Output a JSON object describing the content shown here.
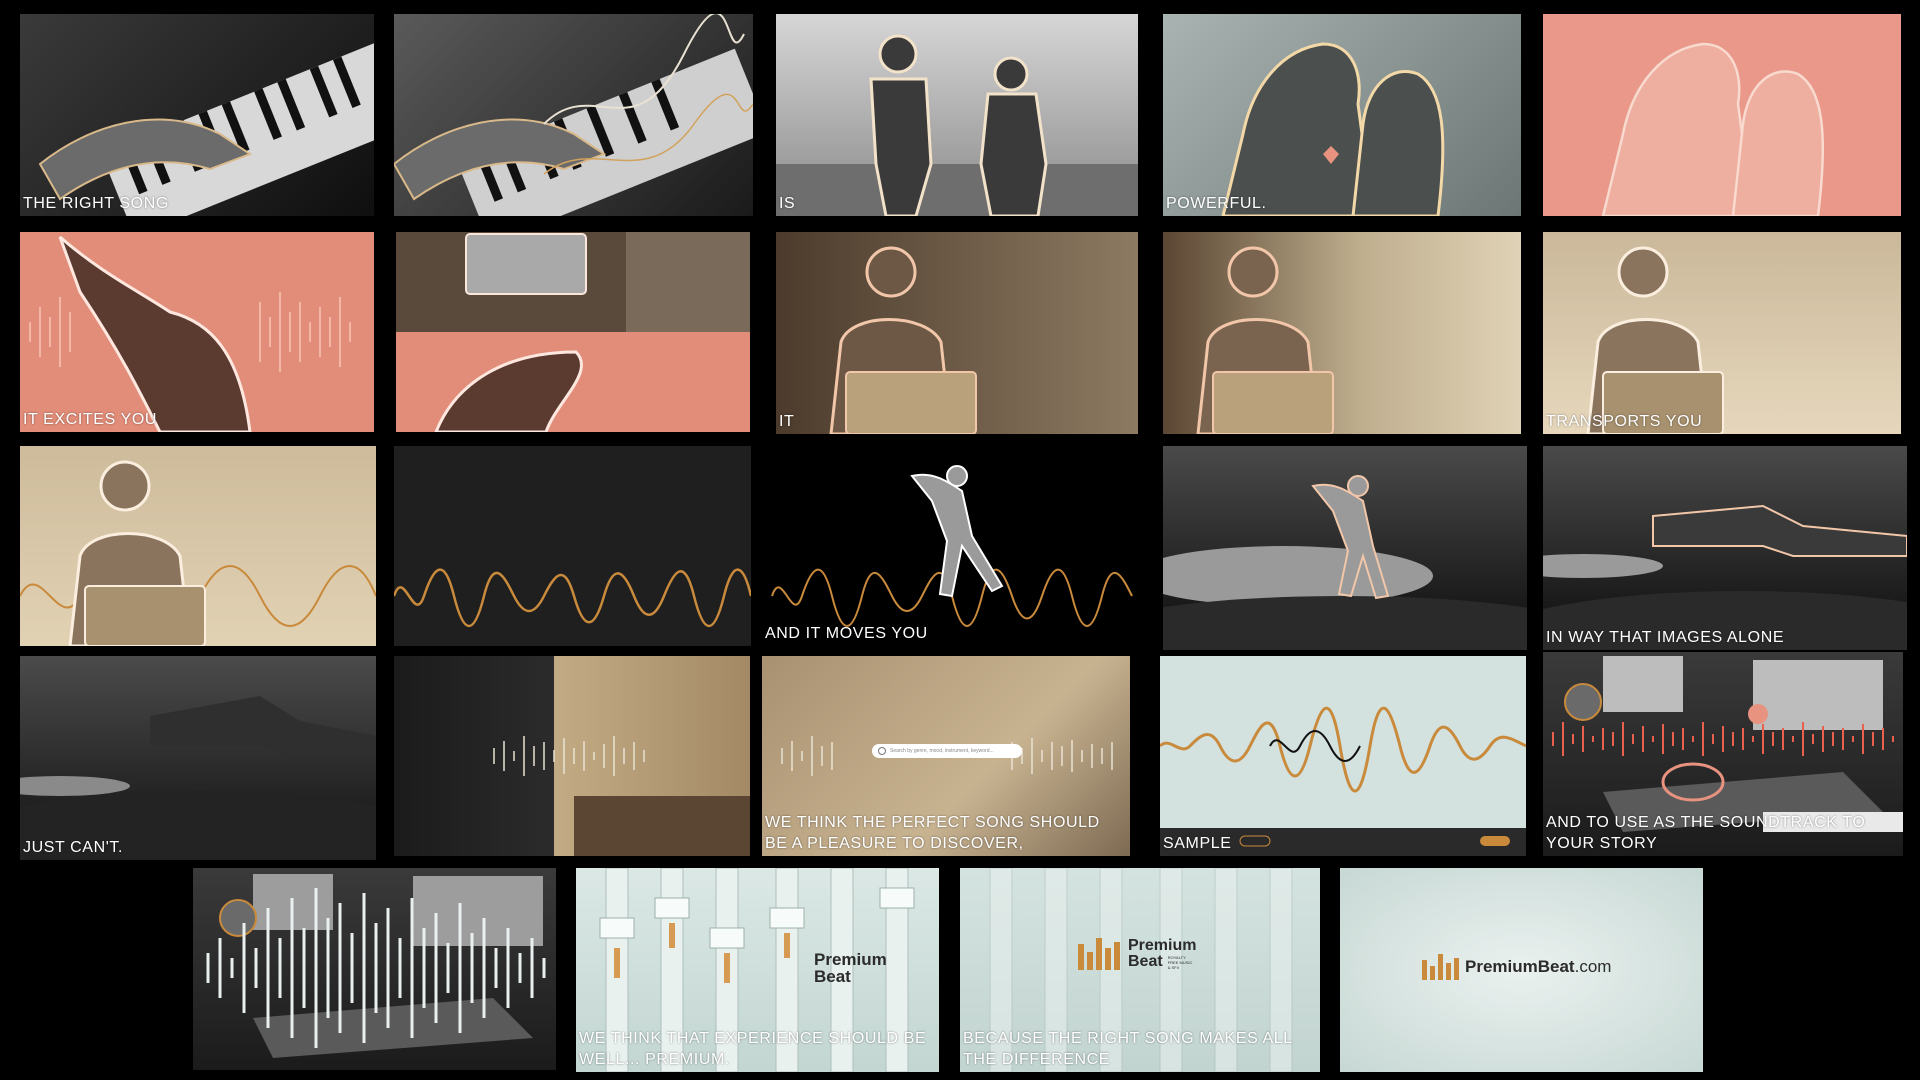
{
  "frames": [
    {
      "caption": "THE RIGHT SONG",
      "icon": "piano-hands"
    },
    {
      "caption": "",
      "icon": "piano-hands"
    },
    {
      "caption": "IS",
      "icon": "couple-holding-hands"
    },
    {
      "caption": "POWERFUL.",
      "icon": "couple-kissing"
    },
    {
      "caption": "",
      "icon": "couple-kissing"
    },
    {
      "caption": "IT EXCITES YOU",
      "icon": "woman-hair-flip"
    },
    {
      "caption": "",
      "icon": "laptop"
    },
    {
      "caption": "IT",
      "icon": "man-with-laptop"
    },
    {
      "caption": "",
      "icon": "man-with-laptop"
    },
    {
      "caption": "TRANSPORTS YOU",
      "icon": "man-with-laptop"
    },
    {
      "caption": "",
      "icon": "man-with-laptop"
    },
    {
      "caption": "",
      "icon": "waveform"
    },
    {
      "caption": "AND IT MOVES YOU",
      "icon": "dancer"
    },
    {
      "caption": "",
      "icon": "dancer-turntable"
    },
    {
      "caption": "IN WAY THAT IMAGES ALONE",
      "icon": "turntable"
    },
    {
      "caption": "JUST CAN'T.",
      "icon": "turntable"
    },
    {
      "caption": "",
      "icon": "record-store"
    },
    {
      "caption": "WE THINK THE PERFECT SONG SHOULD BE A PLEASURE TO DISCOVER,",
      "icon": "record-store-search"
    },
    {
      "caption": "SAMPLE",
      "icon": "waveform-player"
    },
    {
      "caption": "AND TO USE AS THE SOUNDTRACK TO YOUR STORY",
      "icon": "studio"
    },
    {
      "caption": "",
      "icon": "studio-waveform"
    },
    {
      "caption": "WE THINK THAT EXPERIENCE SHOULD BE WELL... PREMIUM.",
      "icon": "mixer-faders"
    },
    {
      "caption": "BECAUSE THE RIGHT SONG MAKES ALL THE DIFFERENCE",
      "icon": "mixer-faders"
    },
    {
      "caption": "",
      "icon": "logo-end-card"
    }
  ],
  "logo": {
    "premium": "Premium",
    "beat": "Beat",
    "tagline": "ROYALTY FREE MUSIC & SFX",
    "domain_main": "PremiumBeat",
    "domain_suffix": ".com"
  },
  "search_placeholder": "Search by genre, mood, instrument, keyword...",
  "colors": {
    "background": "#000000",
    "salmon": "#e79380",
    "sepia": "#b9a17b",
    "gold_wave": "#c98a3c",
    "mint": "#d3e2df"
  }
}
